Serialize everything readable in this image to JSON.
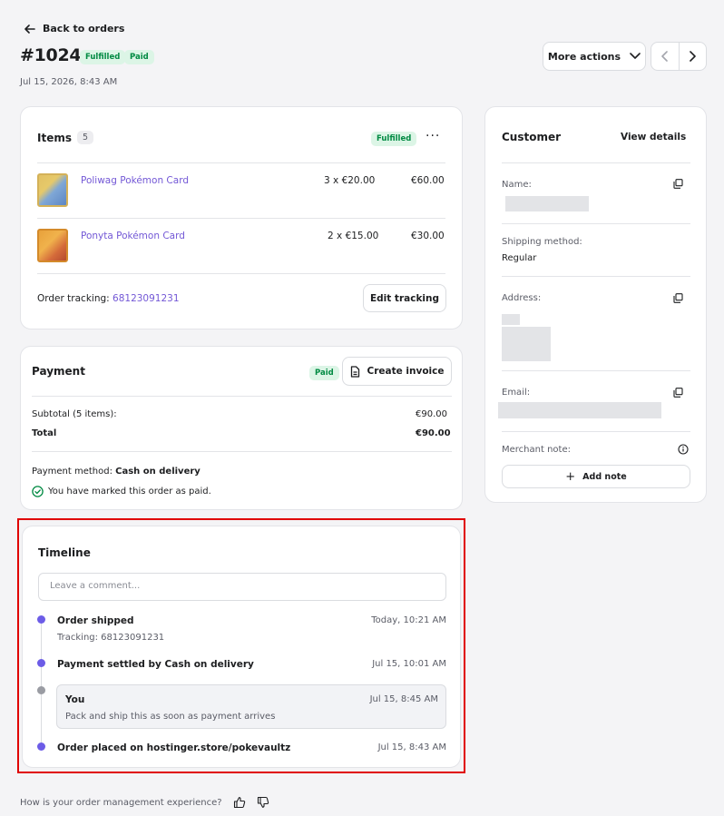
{
  "header": {
    "back_label": "Back to orders",
    "order_number": "#1024",
    "fulfillment_badge": "Fulfilled",
    "payment_badge": "Paid",
    "date": "Jul 15, 2026, 8:43 AM",
    "more_actions_label": "More actions"
  },
  "items": {
    "title": "Items",
    "count": "5",
    "status_badge": "Fulfilled",
    "rows": [
      {
        "name": "Poliwag Pokémon Card",
        "qty_price": "3 x €20.00",
        "total": "€60.00"
      },
      {
        "name": "Ponyta Pokémon Card",
        "qty_price": "2 x €15.00",
        "total": "€30.00"
      }
    ],
    "tracking_label": "Order tracking:",
    "tracking_number": "68123091231",
    "edit_tracking_label": "Edit tracking"
  },
  "payment": {
    "title": "Payment",
    "status_badge": "Paid",
    "create_invoice_label": "Create invoice",
    "subtotal_label": "Subtotal (5 items):",
    "subtotal_value": "€90.00",
    "total_label": "Total",
    "total_value": "€90.00",
    "method_label": "Payment method:",
    "method_value": "Cash on delivery",
    "paid_note": "You have marked this order as paid."
  },
  "customer": {
    "title": "Customer",
    "view_details_label": "View details",
    "name_label": "Name:",
    "shipping_label": "Shipping method:",
    "shipping_value": "Regular",
    "address_label": "Address:",
    "email_label": "Email:",
    "merchant_note_label": "Merchant note:",
    "add_note_label": "Add note"
  },
  "timeline": {
    "title": "Timeline",
    "comment_placeholder": "Leave a comment...",
    "events": [
      {
        "title": "Order shipped",
        "time": "Today, 10:21 AM",
        "detail": "Tracking: 68123091231"
      },
      {
        "title": "Payment settled by Cash on delivery",
        "time": "Jul 15, 10:01 AM"
      },
      {
        "title": "You",
        "time": "Jul 15, 8:45 AM",
        "detail": "Pack and ship this as soon as payment arrives"
      },
      {
        "title": "Order placed on hostinger.store/pokevaultz",
        "time": "Jul 15, 8:43 AM"
      }
    ]
  },
  "feedback": {
    "question": "How is your order management experience?"
  },
  "colors": {
    "accent": "#7358d6",
    "timeline_dot": "#6c5ce7",
    "success": "#008a42",
    "highlight_border": "#e00000"
  }
}
